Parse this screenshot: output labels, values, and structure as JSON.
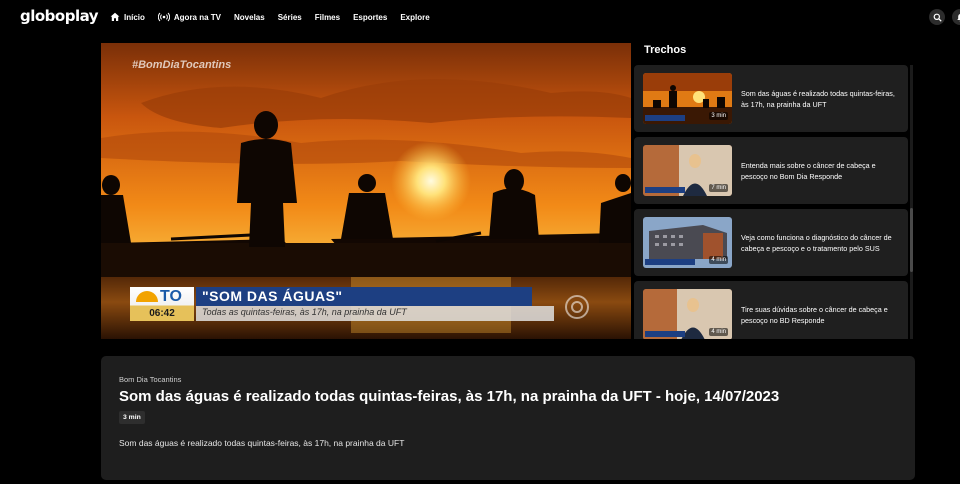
{
  "header": {
    "logo": "globoplay",
    "nav": [
      {
        "label": "Início",
        "icon": "home-icon"
      },
      {
        "label": "Agora na TV",
        "icon": "live-broadcast-icon"
      },
      {
        "label": "Novelas"
      },
      {
        "label": "Séries"
      },
      {
        "label": "Filmes"
      },
      {
        "label": "Esportes"
      },
      {
        "label": "Explore"
      }
    ],
    "search_icon": "search-icon",
    "notification_icon": "bell-icon"
  },
  "player": {
    "hashtag": "#BomDiaTocantins",
    "lower_third": {
      "channel_logo": "TO",
      "clock": "06:42",
      "headline": "\"SOM DAS ÁGUAS\"",
      "subheadline": "Todas as quintas-feiras, às 17h, na prainha da UFT"
    }
  },
  "trechos": {
    "title": "Trechos",
    "items": [
      {
        "duration": "3 min",
        "text": "Som das águas é realizado todas quintas-feiras, às 17h, na prainha da UFT"
      },
      {
        "duration": "7 min",
        "text": "Entenda mais sobre o câncer de cabeça e pescoço no Bom Dia Responde"
      },
      {
        "duration": "4 min",
        "text": "Veja como funciona o diagnóstico do câncer de cabeça e pescoço e o tratamento pelo SUS"
      },
      {
        "duration": "4 min",
        "text": "Tire suas dúvidas sobre o câncer de cabeça e pescoço no BD Responde"
      }
    ]
  },
  "info": {
    "program": "Bom Dia Tocantins",
    "title": "Som das águas é realizado todas quintas-feiras, às 17h, na prainha da UFT - hoje, 14/07/2023",
    "duration": "3 min",
    "description": "Som das águas é realizado todas quintas-feiras, às 17h, na prainha da UFT"
  },
  "colors": {
    "background": "#000000",
    "card": "#1f1f1f",
    "panel": "#1e1e1e",
    "news_blue": "#1d3f82",
    "sunset_orange": "#f28a17"
  }
}
